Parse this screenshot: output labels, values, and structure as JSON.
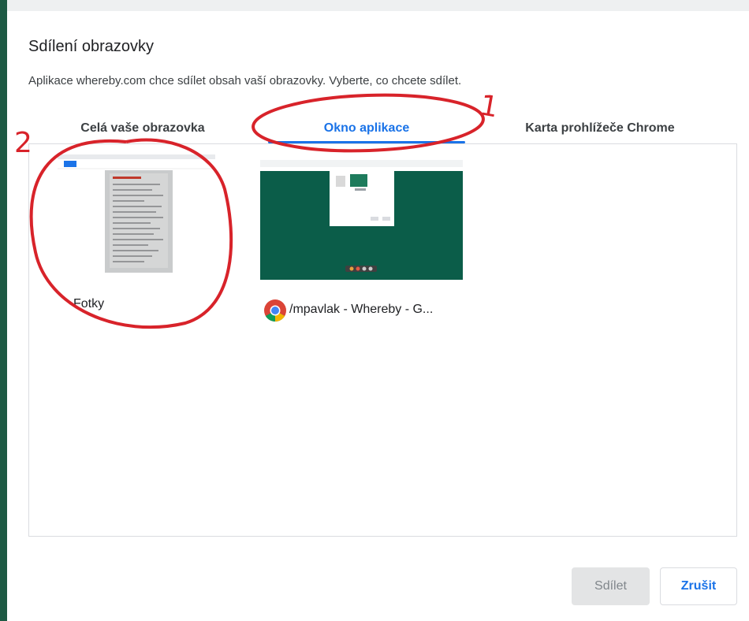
{
  "dialog": {
    "title": "Sdílení obrazovky",
    "subtitle": "Aplikace whereby.com chce sdílet obsah vaší obrazovky. Vyberte, co chcete sdílet."
  },
  "tabs": [
    {
      "label": "Celá vaše obrazovka",
      "active": false
    },
    {
      "label": "Okno aplikace",
      "active": true
    },
    {
      "label": "Karta prohlížeče Chrome",
      "active": false
    }
  ],
  "sources": [
    {
      "label": "Fotky",
      "icon": "none"
    },
    {
      "label": "/mpavlak - Whereby - G...",
      "icon": "chrome-icon"
    }
  ],
  "buttons": {
    "share": "Sdílet",
    "cancel": "Zrušit"
  },
  "annotations": {
    "mark_1": "1",
    "mark_2": "2"
  },
  "colors": {
    "accent": "#1a73e8",
    "annotation": "#d8232a",
    "whereby_green": "#0b5d49"
  }
}
